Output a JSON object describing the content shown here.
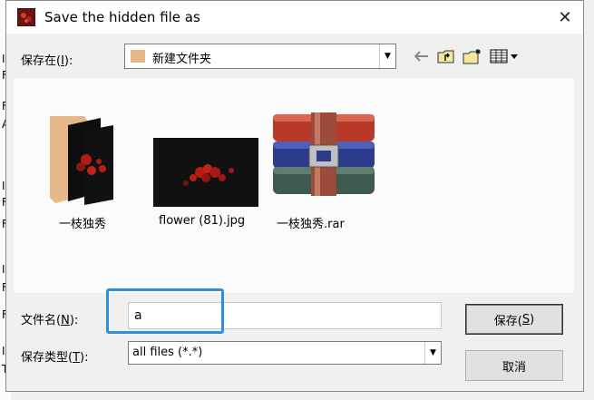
{
  "dialog": {
    "title": "Save the hidden file as",
    "close_symbol": "✕"
  },
  "location": {
    "label_prefix": "保存在(",
    "label_key": "I",
    "label_suffix": "):",
    "current_folder": "新建文件夹"
  },
  "toolbar": {
    "icons": [
      "back-arrow-icon",
      "up-folder-icon",
      "new-folder-icon",
      "view-menu-icon"
    ]
  },
  "files": [
    {
      "name": "一枝独秀",
      "kind": "folder"
    },
    {
      "name": "flower (81).jpg",
      "kind": "image"
    },
    {
      "name": "一枝独秀.rar",
      "kind": "archive"
    }
  ],
  "filename": {
    "label_prefix": "文件名(",
    "label_key": "N",
    "label_suffix": "):",
    "value": "a"
  },
  "filetype": {
    "label_prefix": "保存类型(",
    "label_key": "T",
    "label_suffix": "):",
    "value": "all files (*.*)"
  },
  "buttons": {
    "save_prefix": "保存(",
    "save_key": "S",
    "save_suffix": ")",
    "cancel": "取消"
  },
  "background_chars": [
    "I",
    "F",
    "F",
    "A",
    "I",
    "F",
    "F",
    "I",
    "F",
    "F",
    "I",
    "T"
  ],
  "colors": {
    "focus_ring": "#2e8fdc",
    "folder": "#e8b88a",
    "image_bg": "#111111",
    "flower": "#c0201a"
  }
}
